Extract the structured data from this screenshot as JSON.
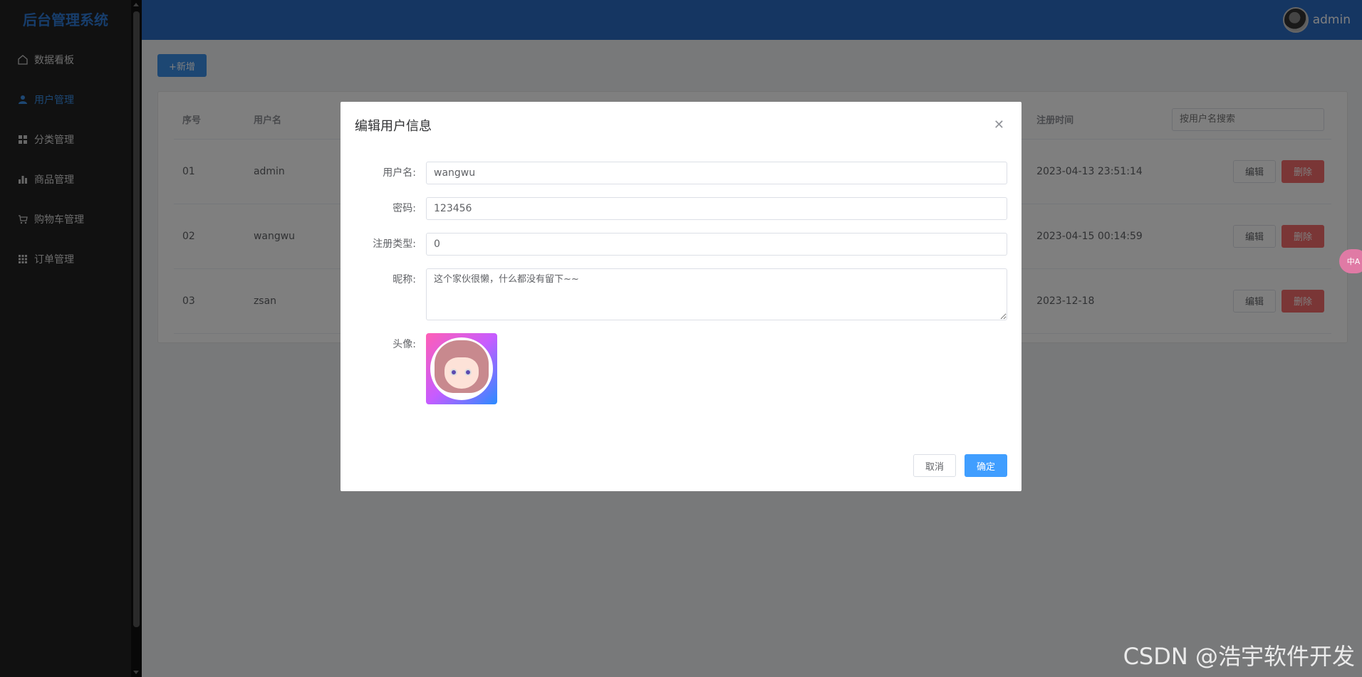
{
  "sidebar": {
    "brand": "后台管理系统",
    "items": [
      {
        "label": "数据看板",
        "icon": "home-icon",
        "active": false
      },
      {
        "label": "用户管理",
        "icon": "user-icon",
        "active": true
      },
      {
        "label": "分类管理",
        "icon": "grid-icon",
        "active": false
      },
      {
        "label": "商品管理",
        "icon": "bar-chart-icon",
        "active": false
      },
      {
        "label": "购物车管理",
        "icon": "cart-icon",
        "active": false
      },
      {
        "label": "订单管理",
        "icon": "apps-icon",
        "active": false
      }
    ]
  },
  "header": {
    "username": "admin"
  },
  "toolbar": {
    "add_label": "+新增"
  },
  "table": {
    "columns": {
      "index": "序号",
      "username": "用户名",
      "reg_time": "注册时间"
    },
    "search_placeholder": "按用户名搜索",
    "rows": [
      {
        "index": "01",
        "username": "admin",
        "reg_time": "2023-04-13 23:51:14"
      },
      {
        "index": "02",
        "username": "wangwu",
        "reg_time": "2023-04-15 00:14:59"
      },
      {
        "index": "03",
        "username": "zsan",
        "reg_time": "2023-12-18"
      }
    ],
    "edit_label": "编辑",
    "delete_label": "删除"
  },
  "dialog": {
    "title": "编辑用户信息",
    "fields": {
      "username_label": "用户名:",
      "username_value": "wangwu",
      "password_label": "密码:",
      "password_value": "123456",
      "reg_type_label": "注册类型:",
      "reg_type_value": "0",
      "nickname_label": "昵称:",
      "nickname_value": "这个家伙很懒，什么都没有留下~~",
      "avatar_label": "头像:"
    },
    "cancel_label": "取消",
    "ok_label": "确定"
  },
  "watermark": "CSDN @浩宇软件开发",
  "translate_badge": "中A",
  "colors": {
    "accent": "#409eff",
    "danger": "#f56c6c",
    "header": "#2b6cc4",
    "sidebar": "#222222"
  }
}
